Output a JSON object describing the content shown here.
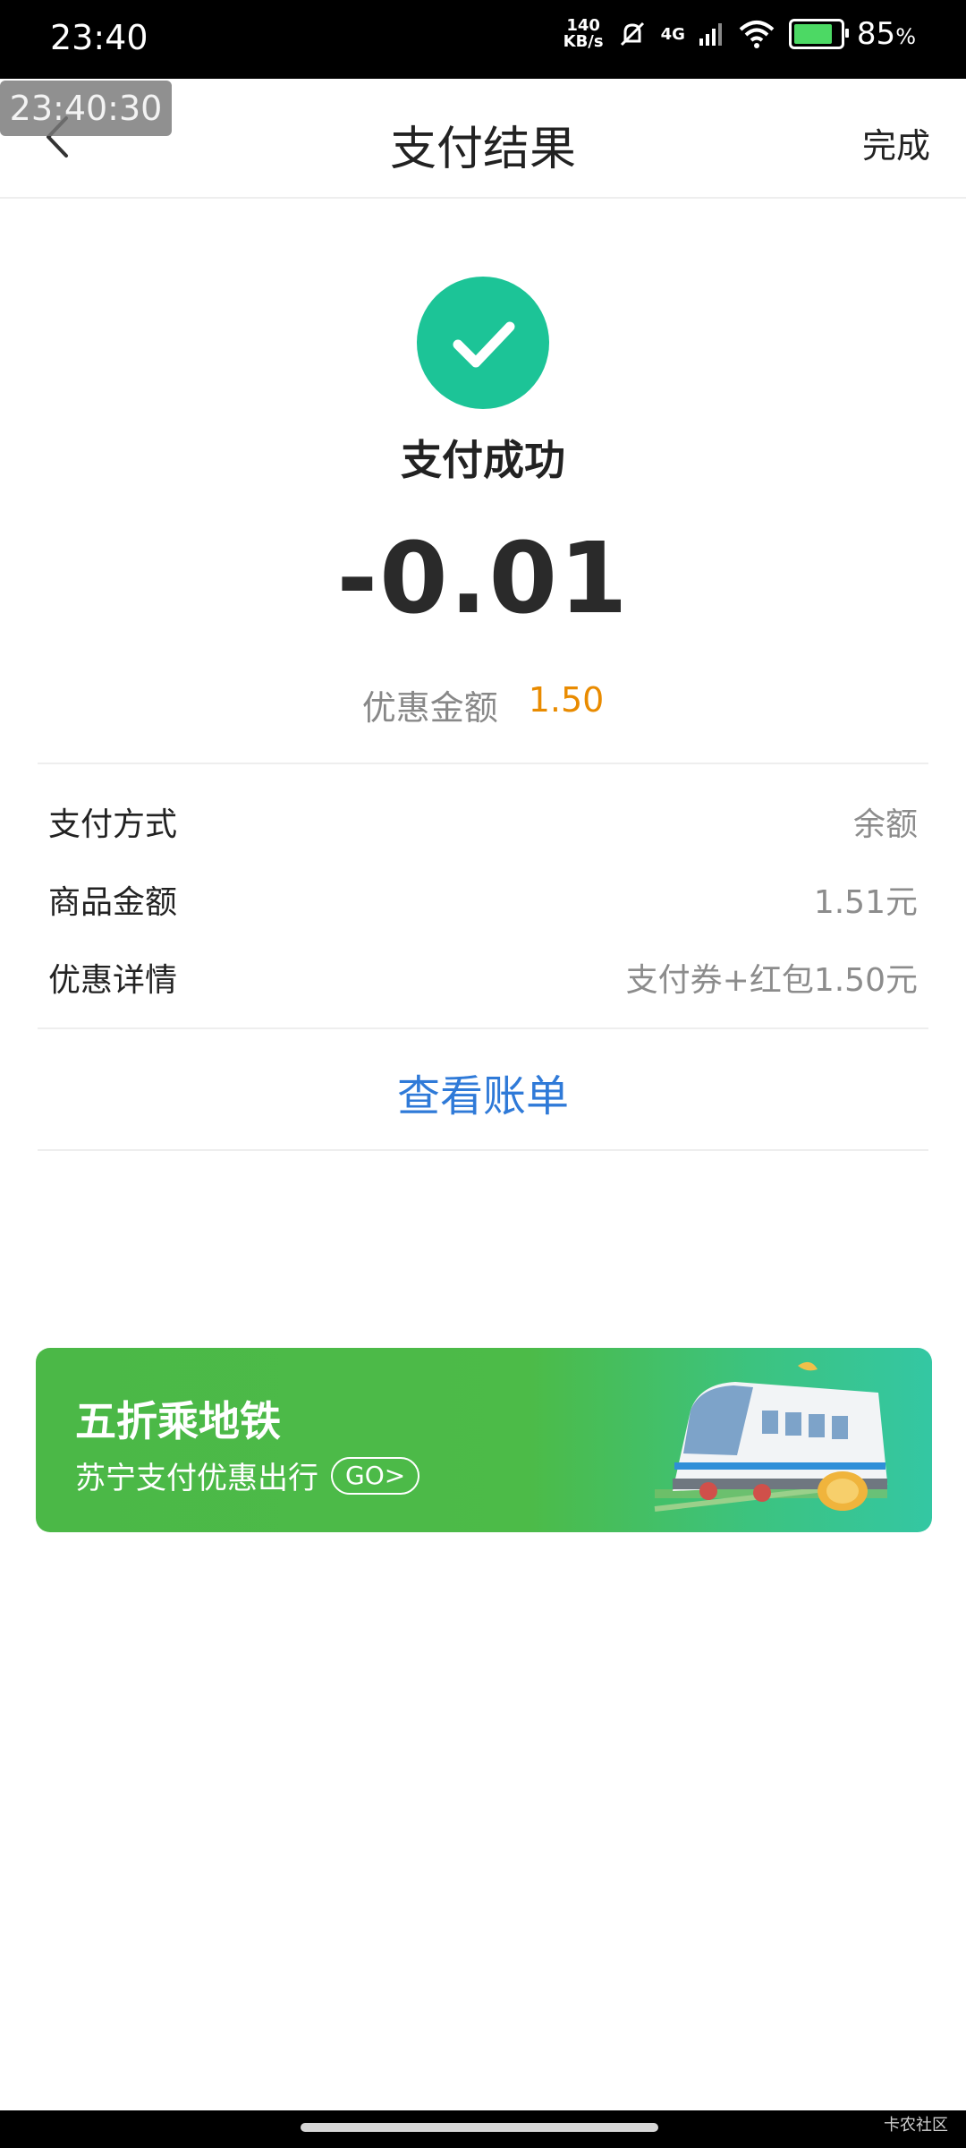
{
  "status_bar": {
    "time": "23:40",
    "net_speed_value": "140",
    "net_speed_unit": "KB/s",
    "network_type": "4G",
    "battery_percent": "85",
    "battery_suffix": "%"
  },
  "overlay": {
    "timestamp": "23:40:30"
  },
  "nav": {
    "title": "支付结果",
    "done_label": "完成"
  },
  "result": {
    "status_text": "支付成功",
    "amount": "-0.01",
    "discount_label": "优惠金额",
    "discount_value": "1.50"
  },
  "details": [
    {
      "label": "支付方式",
      "value": "余额"
    },
    {
      "label": "商品金额",
      "value": "1.51元"
    },
    {
      "label": "优惠详情",
      "value": "支付券+红包1.50元"
    }
  ],
  "view_bill_label": "查看账单",
  "banner": {
    "title": "五折乘地铁",
    "subtitle": "苏宁支付优惠出行",
    "go_label": "GO>"
  },
  "watermark": "卡农社区",
  "colors": {
    "success_green": "#1cc497",
    "link_blue": "#2f7ad8",
    "discount_orange": "#e98b00",
    "banner_green": "#4bb847"
  },
  "icons": [
    "back-chevron-icon",
    "checkmark-icon",
    "mute-bell-icon",
    "signal-icon",
    "wifi-icon",
    "battery-icon",
    "train-illustration"
  ]
}
